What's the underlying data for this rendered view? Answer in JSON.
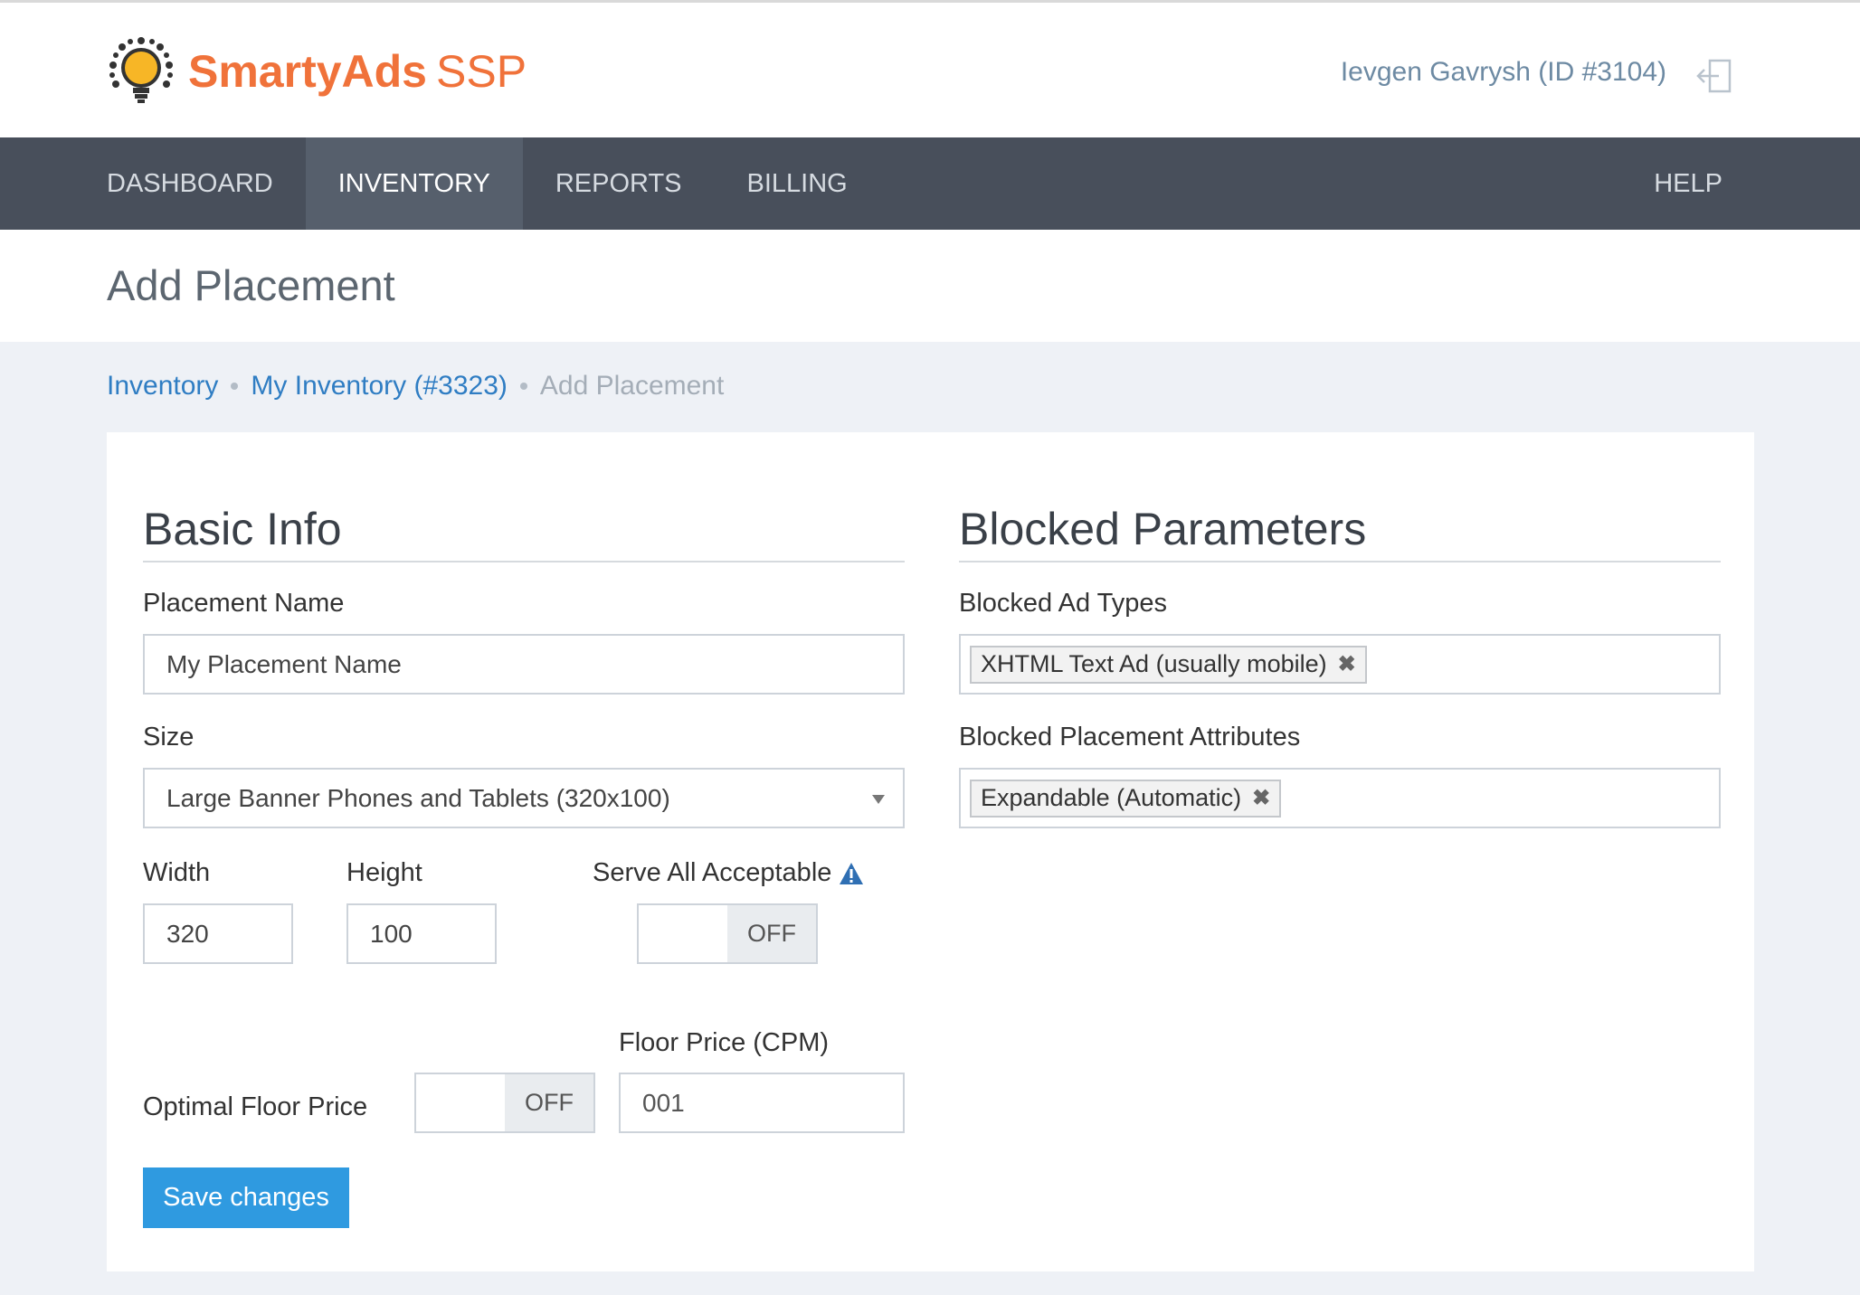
{
  "app": {
    "brand": "SmartyAds",
    "product": "SSP",
    "user": "Ievgen Gavrysh (ID #3104)",
    "logout_icon": "logout-icon"
  },
  "nav": {
    "items": [
      "DASHBOARD",
      "INVENTORY",
      "REPORTS",
      "BILLING"
    ],
    "active": "INVENTORY",
    "help": "HELP"
  },
  "page": {
    "title": "Add Placement"
  },
  "breadcrumb": {
    "items": [
      "Inventory",
      "My Inventory (#3323)"
    ],
    "current": "Add Placement"
  },
  "basic": {
    "title": "Basic Info",
    "name_label": "Placement Name",
    "name_value": "My Placement Name",
    "size_label": "Size",
    "size_value": "Large Banner Phones and Tablets (320x100)",
    "width_label": "Width",
    "width_value": "320",
    "height_label": "Height",
    "height_value": "100",
    "serve_label": "Serve All Acceptable",
    "serve_state": "OFF",
    "floor_label": "Optimal Floor Price",
    "floor_state": "OFF",
    "cpm_label": "Floor Price (CPM)",
    "cpm_value": "001",
    "save_label": "Save changes"
  },
  "blocked": {
    "title": "Blocked Parameters",
    "types_label": "Blocked Ad Types",
    "types_tag": "XHTML Text Ad (usually mobile)",
    "attrs_label": "Blocked Placement Attributes",
    "attrs_tag": "Expandable (Automatic)",
    "remove_glyph": "✖"
  },
  "colors": {
    "accent": "#2f9ae0",
    "brand": "#f0723a",
    "nav_bg": "#484f5b",
    "link": "#2f7dc3"
  }
}
